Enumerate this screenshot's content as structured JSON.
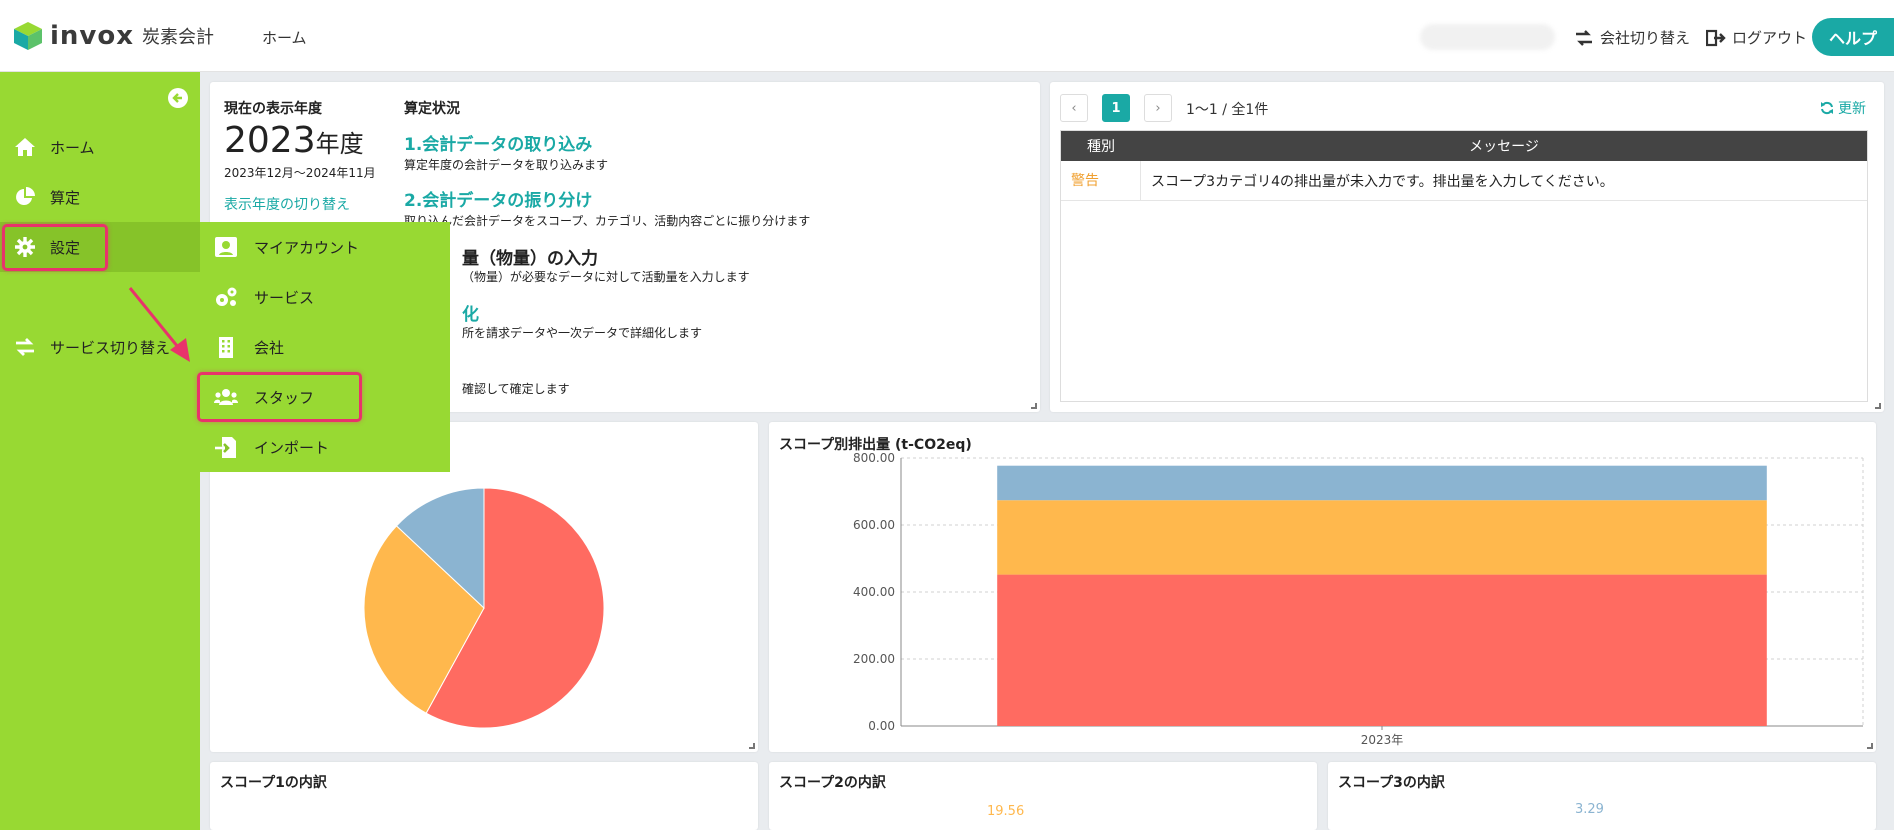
{
  "header": {
    "logo_text": "invox",
    "logo_sub": "炭素会計",
    "home_link": "ホーム",
    "company_switch": "会社切り替え",
    "logout": "ログアウト",
    "help": "ヘルプ"
  },
  "sidebar": {
    "items": [
      {
        "label": "ホーム",
        "icon": "home-icon"
      },
      {
        "label": "算定",
        "icon": "pie-chart-icon"
      },
      {
        "label": "設定",
        "icon": "gear-icon"
      },
      {
        "label": "サービス切り替え",
        "icon": "swap-icon"
      }
    ]
  },
  "submenu": {
    "items": [
      {
        "label": "マイアカウント",
        "icon": "account-icon"
      },
      {
        "label": "サービス",
        "icon": "gears-icon"
      },
      {
        "label": "会社",
        "icon": "building-icon"
      },
      {
        "label": "スタッフ",
        "icon": "users-icon"
      },
      {
        "label": "インポート",
        "icon": "import-icon"
      }
    ]
  },
  "status": {
    "year_label": "現在の表示年度",
    "year": "2023",
    "year_suffix": "年度",
    "year_range": "2023年12月〜2024年11月",
    "year_switch": "表示年度の切り替え",
    "title": "算定状況",
    "steps": [
      {
        "title": "1.会計データの取り込み",
        "desc": "算定年度の会計データを取り込みます"
      },
      {
        "title": "2.会計データの振り分け",
        "desc": "取り込んだ会計データをスコープ、カテゴリ、活動内容ごとに振り分けます"
      },
      {
        "title": "量（物量）の入力",
        "desc": "（物量）が必要なデータに対して活動量を入力します"
      },
      {
        "title": "化",
        "desc": "所を請求データや一次データで詳細化します"
      },
      {
        "title": "",
        "desc": "確認して確定します"
      }
    ]
  },
  "messages": {
    "page": "1",
    "count": "1〜1 / 全1件",
    "refresh": "更新",
    "col_type": "種別",
    "col_message": "メッセージ",
    "rows": [
      {
        "type": "警告",
        "message": "スコープ3カテゴリ4の排出量が未入力です。排出量を入力してください。"
      }
    ]
  },
  "scope_chart": {
    "title": "スコープ別排出量 (t-CO2eq)"
  },
  "chart_data": [
    {
      "type": "pie",
      "values": [
        58,
        29,
        13
      ],
      "colors": [
        "#ff6b61",
        "#ffb84d",
        "#8bb4d1"
      ]
    },
    {
      "type": "bar",
      "title": "スコープ別排出量 (t-CO2eq)",
      "categories": [
        "2023年"
      ],
      "stacked": true,
      "series": [
        {
          "values": [
            452
          ],
          "color": "#ff6b61"
        },
        {
          "values": [
            222
          ],
          "color": "#ffb84d"
        },
        {
          "values": [
            103
          ],
          "color": "#8bb4d1"
        }
      ],
      "ylim": [
        0,
        800
      ],
      "yticks": [
        "800.00",
        "600.00",
        "400.00",
        "200.00",
        "0.00"
      ],
      "grid": true
    }
  ],
  "scopes": [
    {
      "title": "スコープ1の内訳",
      "value": ""
    },
    {
      "title": "スコープ2の内訳",
      "value": "19.56"
    },
    {
      "title": "スコープ3の内訳",
      "value": "3.29"
    }
  ]
}
